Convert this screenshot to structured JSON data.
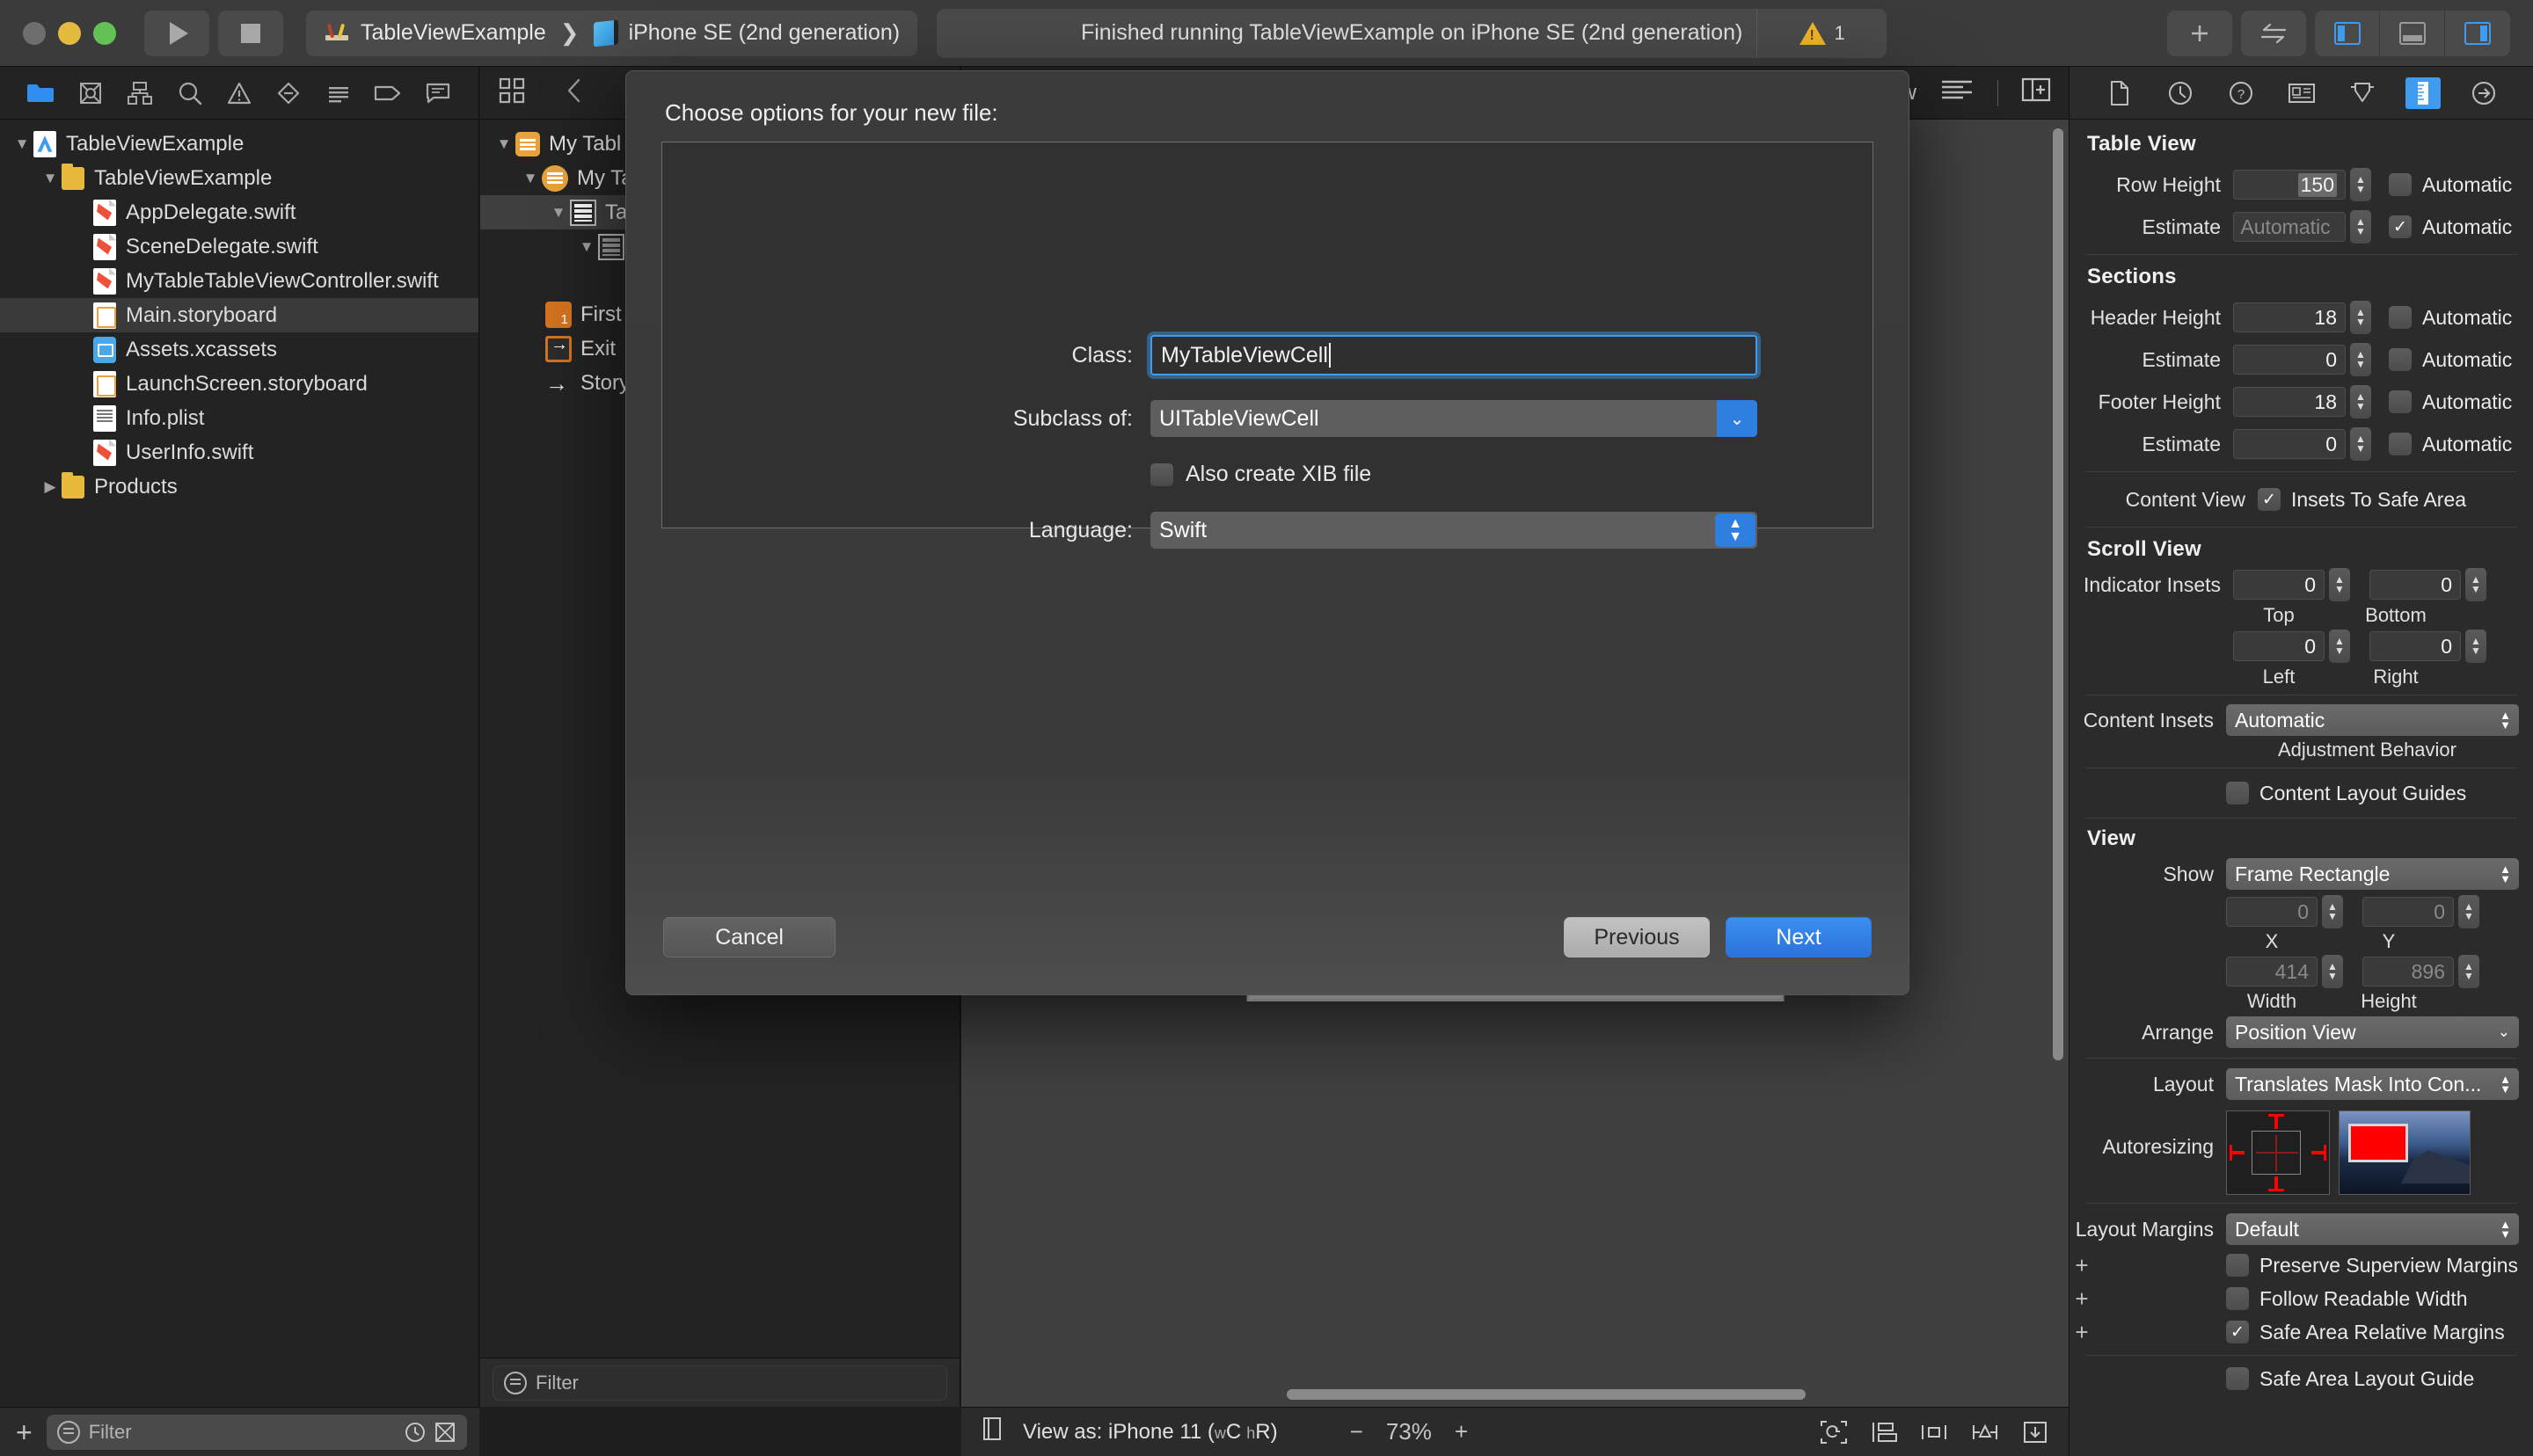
{
  "titlebar": {
    "scheme_project": "TableViewExample",
    "scheme_device": "iPhone SE (2nd generation)",
    "status_text": "Finished running TableViewExample on iPhone SE (2nd generation)",
    "warning_count": "1",
    "add_label": "+",
    "icons": {
      "run": "run-icon",
      "stop": "stop-icon",
      "add": "add-icon",
      "swap": "swap-icon"
    }
  },
  "navigator": {
    "tabs": [
      {
        "name": "project-navigator",
        "icon": "folder-icon",
        "active": true
      },
      {
        "name": "source-control-navigator",
        "icon": "source-control-icon",
        "active": false
      },
      {
        "name": "symbol-navigator",
        "icon": "hierarchy-icon",
        "active": false
      },
      {
        "name": "find-navigator",
        "icon": "search-icon",
        "active": false
      },
      {
        "name": "issue-navigator",
        "icon": "warning-icon",
        "active": false
      },
      {
        "name": "test-navigator",
        "icon": "diamond-icon",
        "active": false
      },
      {
        "name": "debug-navigator",
        "icon": "list-icon",
        "active": false
      },
      {
        "name": "breakpoint-navigator",
        "icon": "tag-icon",
        "active": false
      },
      {
        "name": "report-navigator",
        "icon": "message-icon",
        "active": false
      }
    ],
    "tree": [
      {
        "label": "TableViewExample",
        "icon": "project-icon",
        "indent": 0,
        "twisty": "down",
        "selected": false
      },
      {
        "label": "TableViewExample",
        "icon": "folder-icon",
        "indent": 1,
        "twisty": "down",
        "selected": false
      },
      {
        "label": "AppDelegate.swift",
        "icon": "swift-icon",
        "indent": 2,
        "twisty": "",
        "selected": false
      },
      {
        "label": "SceneDelegate.swift",
        "icon": "swift-icon",
        "indent": 2,
        "twisty": "",
        "selected": false
      },
      {
        "label": "MyTableTableViewController.swift",
        "icon": "swift-icon",
        "indent": 2,
        "twisty": "",
        "selected": false
      },
      {
        "label": "Main.storyboard",
        "icon": "storyboard-icon",
        "indent": 2,
        "twisty": "",
        "selected": true
      },
      {
        "label": "Assets.xcassets",
        "icon": "xcassets-icon",
        "indent": 2,
        "twisty": "",
        "selected": false
      },
      {
        "label": "LaunchScreen.storyboard",
        "icon": "storyboard-icon",
        "indent": 2,
        "twisty": "",
        "selected": false
      },
      {
        "label": "Info.plist",
        "icon": "plist-icon",
        "indent": 2,
        "twisty": "",
        "selected": false
      },
      {
        "label": "UserInfo.swift",
        "icon": "swift-icon",
        "indent": 2,
        "twisty": "",
        "selected": false
      },
      {
        "label": "Products",
        "icon": "folder-icon",
        "indent": 1,
        "twisty": "right",
        "selected": false
      }
    ],
    "filter_placeholder": "Filter"
  },
  "outline": {
    "filter_placeholder": "Filter",
    "rows": [
      {
        "label": "My Tabl",
        "icon": "view-controller-scene-icon",
        "indent": 0,
        "twisty": "down",
        "selected": false
      },
      {
        "label": "My Ta",
        "icon": "view-controller-icon",
        "indent": 1,
        "twisty": "down",
        "selected": false
      },
      {
        "label": "Ta",
        "icon": "table-view-icon",
        "indent": 2,
        "twisty": "down",
        "selected": true
      },
      {
        "label": "",
        "icon": "table-view-cell-icon",
        "indent": 3,
        "twisty": "down",
        "selected": false
      },
      {
        "label": "First",
        "icon": "first-responder-icon",
        "indent": 1,
        "twisty": "",
        "selected": false
      },
      {
        "label": "Exit",
        "icon": "exit-icon",
        "indent": 1,
        "twisty": "",
        "selected": false
      },
      {
        "label": "Story",
        "icon": "storyboard-entry-point-icon",
        "indent": 1,
        "twisty": "",
        "selected": false
      }
    ]
  },
  "editor": {
    "label_right": "View",
    "align_icon": "align-icon",
    "add_editor_icon": "add-editor-icon"
  },
  "canvas_bottom": {
    "view_as": "View as: iPhone 11 (wC hR)",
    "view_as_prefix": "View as: iPhone 11 (",
    "trait_w": "w",
    "trait_wv": "C",
    "trait_h": "h",
    "trait_hv": "R",
    "view_as_suffix": ")",
    "zoom_out": "−",
    "zoom_level": "73%",
    "zoom_in": "+",
    "icons": [
      "update-frames-icon",
      "embed-in-icon",
      "align-icon",
      "add-constraints-icon",
      "resolve-auto-layout-icon"
    ]
  },
  "inspector": {
    "tabs": [
      {
        "name": "file-inspector",
        "icon": "document-icon",
        "active": false
      },
      {
        "name": "history-inspector",
        "icon": "clock-icon",
        "active": false
      },
      {
        "name": "quick-help-inspector",
        "icon": "question-icon",
        "active": false
      },
      {
        "name": "identity-inspector",
        "icon": "id-card-icon",
        "active": false
      },
      {
        "name": "attributes-inspector",
        "icon": "slider-shield-icon",
        "active": false
      },
      {
        "name": "size-inspector",
        "icon": "ruler-icon",
        "active": true
      },
      {
        "name": "connections-inspector",
        "icon": "arrow-circle-icon",
        "active": false
      }
    ],
    "table_view": {
      "title": "Table View",
      "rows": [
        {
          "label": "Row Height",
          "value": "150",
          "placeholder": false,
          "checkbox_label": "Automatic",
          "checked": false
        },
        {
          "label": "Estimate",
          "value": "Automatic",
          "placeholder": true,
          "checkbox_label": "Automatic",
          "checked": true
        }
      ]
    },
    "sections": {
      "title": "Sections",
      "rows": [
        {
          "label": "Header Height",
          "value": "18",
          "placeholder": false,
          "checkbox_label": "Automatic",
          "checked": false
        },
        {
          "label": "Estimate",
          "value": "0",
          "placeholder": false,
          "checkbox_label": "Automatic",
          "checked": false
        },
        {
          "label": "Footer Height",
          "value": "18",
          "placeholder": false,
          "checkbox_label": "Automatic",
          "checked": false
        },
        {
          "label": "Estimate",
          "value": "0",
          "placeholder": false,
          "checkbox_label": "Automatic",
          "checked": false
        }
      ]
    },
    "content_view": {
      "label": "Content View",
      "checkbox_label": "Insets To Safe Area",
      "checked": true
    },
    "scroll_view": {
      "title": "Scroll View",
      "indicator_insets_label": "Indicator Insets",
      "top": {
        "value": "0",
        "label": "Top"
      },
      "bottom": {
        "value": "0",
        "label": "Bottom"
      },
      "left": {
        "value": "0",
        "label": "Left"
      },
      "right": {
        "value": "0",
        "label": "Right"
      },
      "content_insets_label": "Content Insets",
      "content_insets_value": "Automatic",
      "adjustment_behavior_label": "Adjustment Behavior",
      "content_layout_guides_label": "Content Layout Guides",
      "content_layout_guides_checked": false
    },
    "view": {
      "title": "View",
      "show_label": "Show",
      "show_value": "Frame Rectangle",
      "x": {
        "value": "0",
        "label": "X"
      },
      "y": {
        "value": "0",
        "label": "Y"
      },
      "width": {
        "value": "414",
        "label": "Width"
      },
      "height": {
        "value": "896",
        "label": "Height"
      },
      "arrange_label": "Arrange",
      "arrange_value": "Position View",
      "layout_label": "Layout",
      "layout_value": "Translates Mask Into Con...",
      "autoresizing_label": "Autoresizing",
      "layout_margins_label": "Layout Margins",
      "layout_margins_value": "Default",
      "checks": [
        {
          "label": "Preserve Superview Margins",
          "checked": false
        },
        {
          "label": "Follow Readable Width",
          "checked": false
        },
        {
          "label": "Safe Area Relative Margins",
          "checked": true
        },
        {
          "label": "Safe Area Layout Guide",
          "checked": false
        }
      ]
    }
  },
  "modal": {
    "title": "Choose options for your new file:",
    "class_label": "Class:",
    "class_value": "MyTableViewCell",
    "subclass_label": "Subclass of:",
    "subclass_value": "UITableViewCell",
    "xib_label": "Also create XIB file",
    "xib_checked": false,
    "language_label": "Language:",
    "language_value": "Swift",
    "cancel_label": "Cancel",
    "previous_label": "Previous",
    "next_label": "Next"
  },
  "colors": {
    "accent_blue": "#3f9bf0",
    "primary_button": "#2b72db",
    "warning_yellow": "#f0b429",
    "swift_orange": "#ef5138",
    "folder_yellow": "#e8b93c"
  }
}
